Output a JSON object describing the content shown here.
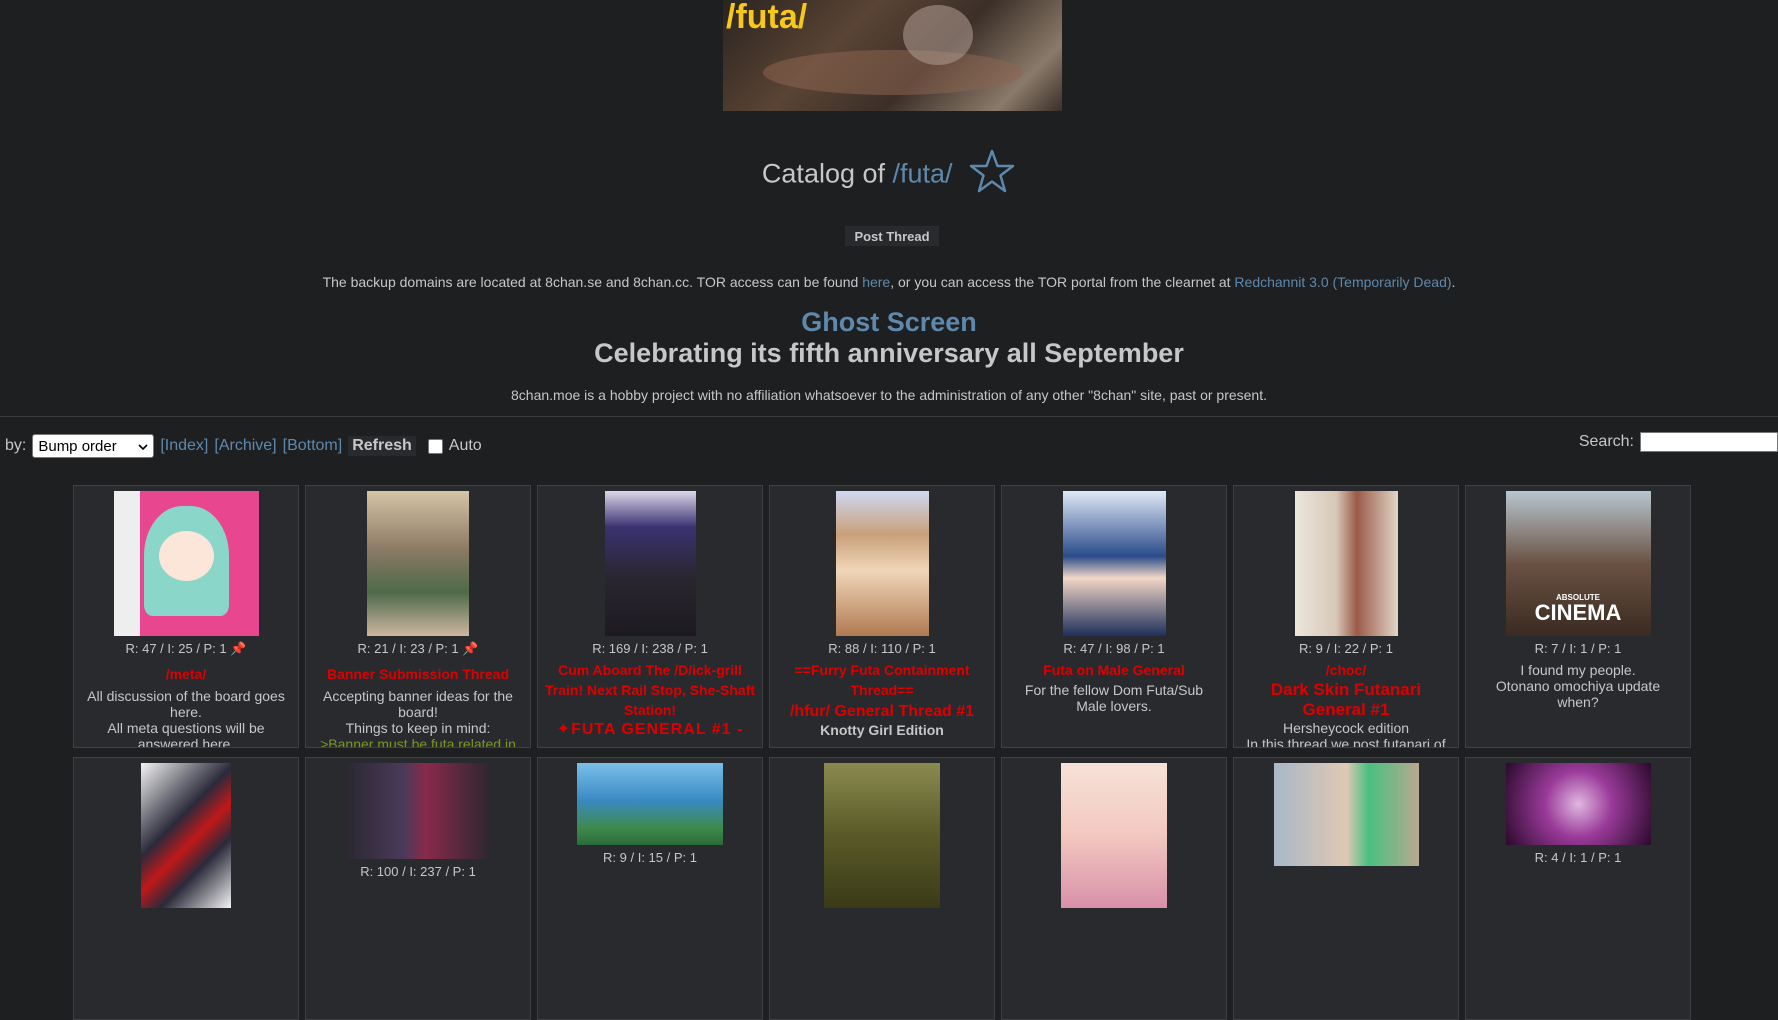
{
  "banner": {
    "text": "/futa/"
  },
  "header": {
    "catalog_prefix": "Catalog of ",
    "board_link": "/futa/"
  },
  "post_thread_label": "Post Thread",
  "backup": {
    "text1": "The backup domains are located at 8chan.se and 8chan.cc. TOR access can be found ",
    "link1": "here",
    "text2": ", or you can access the TOR portal from the clearnet at ",
    "link2": "Redchannit 3.0 (Temporarily Dead)",
    "text3": "."
  },
  "ghost_title": "Ghost Screen",
  "anniversary": "Celebrating its fifth anniversary all September",
  "disclaimer": "8chan.moe is a hobby project with no affiliation whatsoever to the administration of any other \"8chan\" site, past or present.",
  "controls": {
    "sort_prefix": "by:",
    "sort_selected": "Bump order",
    "index_link": "[Index]",
    "archive_link": "[Archive]",
    "bottom_link": "[Bottom]",
    "refresh_label": "Refresh",
    "auto_label": "Auto",
    "search_label": "Search:"
  },
  "colors": {
    "background": "#1d1f21",
    "cell": "#282a2e",
    "link": "#5f89ac",
    "subject": "#dd0000",
    "greentext": "#789922"
  },
  "threads": [
    {
      "stats": "R: 47 / I: 25 / P: 1",
      "pinned": true,
      "subject": "/meta/",
      "body": "All discussion of the board goes here.",
      "body2": "All meta questions will be answered here.",
      "thumb_color": "#e8478f"
    },
    {
      "stats": "R: 21 / I: 23 / P: 1",
      "pinned": true,
      "subject": "Banner Submission Thread",
      "body": "Accepting banner ideas for the board!",
      "body2": "Things to keep in mind:",
      "green": ">Banner must be futa related in",
      "thumb_color": "#a89682"
    },
    {
      "stats": "R: 169 / I: 238 / P: 1",
      "pinned": false,
      "subject": "Cum Aboard The /D/ick-grill Train! Next Rail Stop, She-Shaft Station!",
      "extra": "✦FUTA GENERAL #1 -",
      "thumb_color": "#3c3650"
    },
    {
      "stats": "R: 88 / I: 110 / P: 1",
      "pinned": false,
      "subject": "==Furry Futa Containment Thread==",
      "subject2": "/hfur/ General Thread #1",
      "extra": "Knotty Girl Edition",
      "thumb_color": "#c9a07a"
    },
    {
      "stats": "R: 47 / I: 98 / P: 1",
      "pinned": false,
      "subject": "Futa on Male General",
      "body": "For the fellow Dom Futa/Sub Male lovers.",
      "thumb_color": "#6f8fc8"
    },
    {
      "stats": "R: 9 / I: 22 / P: 1",
      "pinned": false,
      "subject": "/choc/",
      "subject2": "Dark Skin Futanari General #1",
      "body": "Hersheycock edition",
      "body2": "In this thread we post futanari of a",
      "thumb_color": "#9c5a48"
    },
    {
      "stats": "R: 7 / I: 1 / P: 1",
      "pinned": false,
      "body": "I found my people.",
      "body2": "Otonano omochiya update when?",
      "overlay": "ABSOLUTE CINEMA",
      "thumb_color": "#5a4a3e"
    }
  ],
  "threads_row2": [
    {
      "stats": "",
      "thumb_color": "#efefef"
    },
    {
      "stats": "R: 100 / I: 237 / P: 1",
      "thumb_color": "#2a2830"
    },
    {
      "stats": "R: 9 / I: 15 / P: 1",
      "thumb_color": "#4aa2d4"
    },
    {
      "stats": "",
      "thumb_color": "#6a6a30"
    },
    {
      "stats": "",
      "thumb_color": "#f2c8c0"
    },
    {
      "stats": "",
      "thumb_color": "#7ab0d0"
    },
    {
      "stats": "R: 4 / I: 1 / P: 1",
      "thumb_color": "#9a3a9a"
    }
  ]
}
